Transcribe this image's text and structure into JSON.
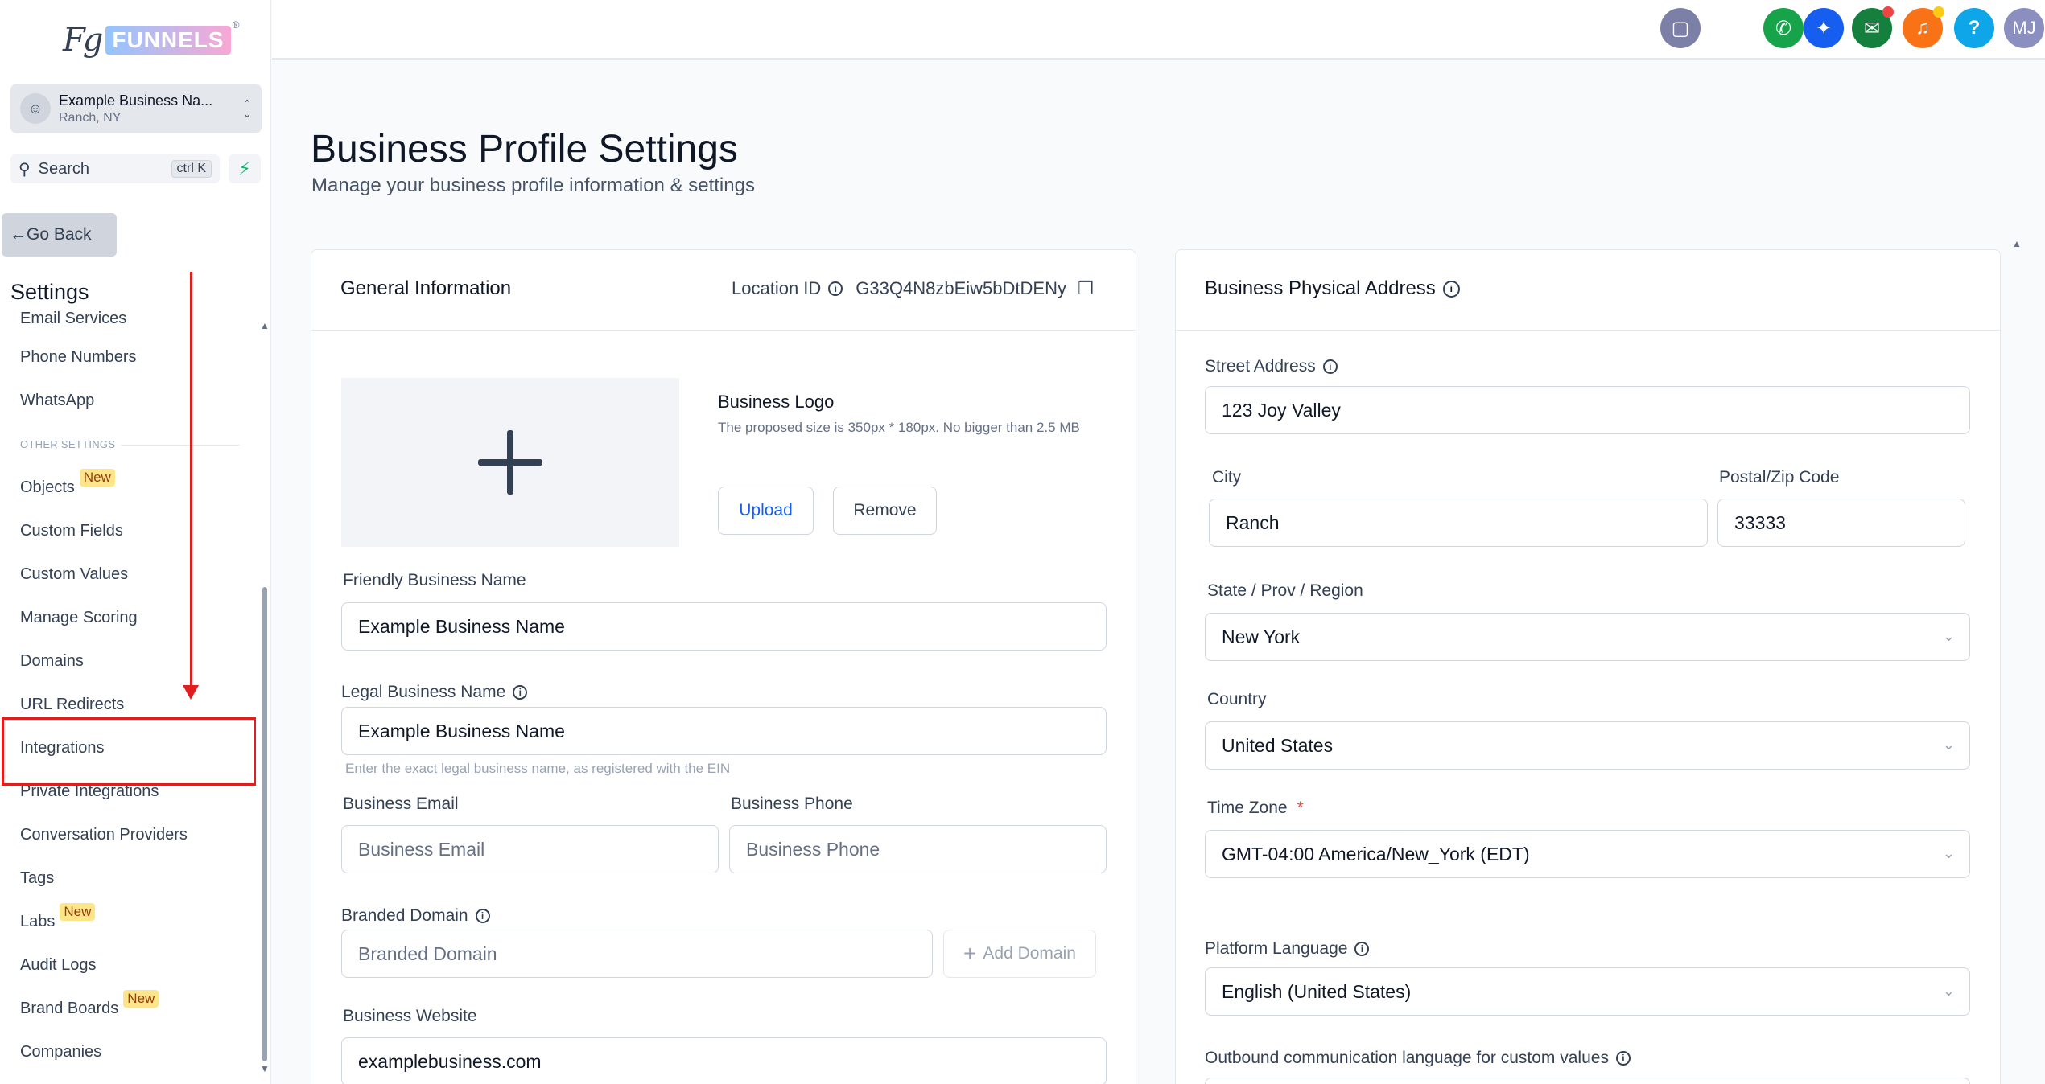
{
  "brand": {
    "fg": "Fg",
    "funnels": "FUNNELS",
    "reg": "®"
  },
  "account": {
    "name": "Example Business Na...",
    "location": "Ranch, NY"
  },
  "search": {
    "label": "Search",
    "shortcut": "ctrl K"
  },
  "sidebar": {
    "go_back": "Go Back",
    "title": "Settings",
    "partial_item": "Email Services",
    "items": [
      {
        "label": "Phone Numbers"
      },
      {
        "label": "WhatsApp"
      },
      {
        "label": "Objects",
        "badge": "New"
      },
      {
        "label": "Custom Fields"
      },
      {
        "label": "Custom Values"
      },
      {
        "label": "Manage Scoring"
      },
      {
        "label": "Domains"
      },
      {
        "label": "URL Redirects"
      },
      {
        "label": "Integrations"
      },
      {
        "label": "Private Integrations"
      },
      {
        "label": "Conversation Providers"
      },
      {
        "label": "Tags"
      },
      {
        "label": "Labs",
        "badge": "New"
      },
      {
        "label": "Audit Logs"
      },
      {
        "label": "Brand Boards",
        "badge": "New"
      },
      {
        "label": "Companies"
      }
    ],
    "section_other": "OTHER SETTINGS"
  },
  "topbar": {
    "avatar_initials": "MJ",
    "help": "?"
  },
  "page": {
    "title": "Business Profile Settings",
    "subtitle": "Manage your business profile information & settings"
  },
  "general": {
    "title": "General Information",
    "location_id_label": "Location ID",
    "location_id_value": "G33Q4N8zbEiw5bDtDENy",
    "logo_title": "Business Logo",
    "logo_hint": "The proposed size is 350px * 180px. No bigger than 2.5 MB",
    "upload": "Upload",
    "remove": "Remove",
    "friendly_label": "Friendly Business Name",
    "friendly_value": "Example Business Name",
    "legal_label": "Legal Business Name",
    "legal_value": "Example Business Name",
    "legal_hint": "Enter the exact legal business name, as registered with the EIN",
    "email_label": "Business Email",
    "email_placeholder": "Business Email",
    "phone_label": "Business Phone",
    "phone_placeholder": "Business Phone",
    "domain_label": "Branded Domain",
    "domain_placeholder": "Branded Domain",
    "add_domain": "Add Domain",
    "website_label": "Business Website",
    "website_value": "examplebusiness.com"
  },
  "address": {
    "title": "Business Physical Address",
    "street_label": "Street Address",
    "street_value": "123 Joy Valley",
    "city_label": "City",
    "city_value": "Ranch",
    "zip_label": "Postal/Zip Code",
    "zip_value": "33333",
    "state_label": "State / Prov / Region",
    "state_value": "New York",
    "country_label": "Country",
    "country_value": "United States",
    "tz_label": "Time Zone",
    "tz_required": "*",
    "tz_value": "GMT-04:00 America/New_York (EDT)",
    "lang_label": "Platform Language",
    "lang_value": "English (United States)",
    "outbound_label": "Outbound communication language for custom values"
  },
  "colors": {
    "accent": "#155eef",
    "annotation_red": "#e11d1d",
    "badge_bg": "#fde68a",
    "phone_green": "#16a34a",
    "bell_orange": "#f97316"
  }
}
